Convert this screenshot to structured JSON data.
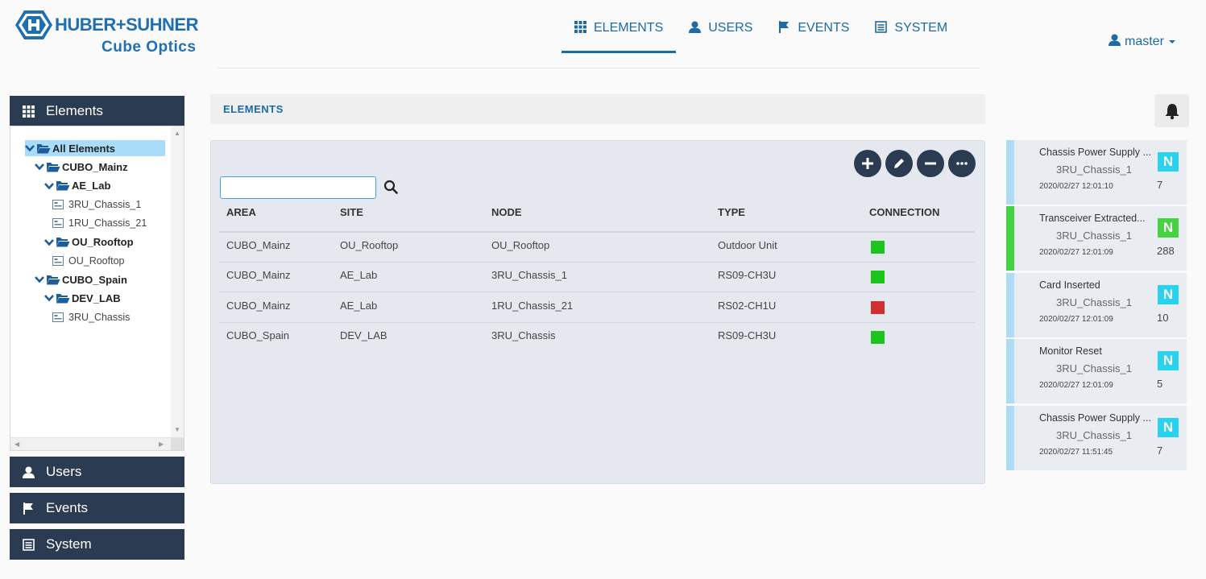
{
  "brand": {
    "name": "HUBER+SUHNER",
    "product": "Cube Optics"
  },
  "topnav": [
    {
      "label": "ELEMENTS",
      "icon": "grid-icon",
      "active": true
    },
    {
      "label": "USERS",
      "icon": "user-icon",
      "active": false
    },
    {
      "label": "EVENTS",
      "icon": "flag-icon",
      "active": false
    },
    {
      "label": "SYSTEM",
      "icon": "list-icon",
      "active": false
    }
  ],
  "user": {
    "name": "master",
    "icon": "user-icon"
  },
  "sidebar": {
    "elements_label": "Elements",
    "users_label": "Users",
    "events_label": "Events",
    "system_label": "System",
    "tree": [
      {
        "label": "All Elements",
        "type": "folder",
        "level": 0,
        "selected": true
      },
      {
        "label": "CUBO_Mainz",
        "type": "folder",
        "level": 1
      },
      {
        "label": "AE_Lab",
        "type": "folder",
        "level": 2
      },
      {
        "label": "3RU_Chassis_1",
        "type": "leaf",
        "level": 3
      },
      {
        "label": "1RU_Chassis_21",
        "type": "leaf",
        "level": 3
      },
      {
        "label": "OU_Rooftop",
        "type": "folder",
        "level": 2
      },
      {
        "label": "OU_Rooftop",
        "type": "leaf",
        "level": 3
      },
      {
        "label": "CUBO_Spain",
        "type": "folder",
        "level": 1
      },
      {
        "label": "DEV_LAB",
        "type": "folder",
        "level": 2
      },
      {
        "label": "3RU_Chassis",
        "type": "leaf",
        "level": 3
      }
    ]
  },
  "main": {
    "section_title": "ELEMENTS",
    "search": {
      "value": "",
      "placeholder": ""
    },
    "actions": [
      "add-icon",
      "edit-icon",
      "remove-icon",
      "more-icon"
    ],
    "columns": [
      "AREA",
      "SITE",
      "NODE",
      "TYPE",
      "CONNECTION"
    ],
    "rows": [
      {
        "area": "CUBO_Mainz",
        "site": "OU_Rooftop",
        "node": "OU_Rooftop",
        "type": "Outdoor Unit",
        "connection": "ok"
      },
      {
        "area": "CUBO_Mainz",
        "site": "AE_Lab",
        "node": "3RU_Chassis_1",
        "type": "RS09-CH3U",
        "connection": "ok"
      },
      {
        "area": "CUBO_Mainz",
        "site": "AE_Lab",
        "node": "1RU_Chassis_21",
        "type": "RS02-CH1U",
        "connection": "error"
      },
      {
        "area": "CUBO_Spain",
        "site": "DEV_LAB",
        "node": "3RU_Chassis",
        "type": "RS09-CH3U",
        "connection": "ok"
      }
    ]
  },
  "events": [
    {
      "title": "Chassis Power Supply ...",
      "node": "3RU_Chassis_1",
      "time": "2020/02/27 12:01:10",
      "badge": "N",
      "count": "7",
      "badge_color": "#29d3f0",
      "stripe_color": "#aedcf6"
    },
    {
      "title": "Transceiver Extracted...",
      "node": "3RU_Chassis_1",
      "time": "2020/02/27 12:01:09",
      "badge": "N",
      "count": "288",
      "badge_color": "#45d343",
      "stripe_color": "#45d343"
    },
    {
      "title": "Card Inserted",
      "node": "3RU_Chassis_1",
      "time": "2020/02/27 12:01:09",
      "badge": "N",
      "count": "10",
      "badge_color": "#29d3f0",
      "stripe_color": "#aedcf6"
    },
    {
      "title": "Monitor Reset",
      "node": "3RU_Chassis_1",
      "time": "2020/02/27 12:01:09",
      "badge": "N",
      "count": "5",
      "badge_color": "#29d3f0",
      "stripe_color": "#aedcf6"
    },
    {
      "title": "Chassis Power Supply ...",
      "node": "3RU_Chassis_1",
      "time": "2020/02/27 11:51:45",
      "badge": "N",
      "count": "7",
      "badge_color": "#29d3f0",
      "stripe_color": "#aedcf6"
    }
  ],
  "colors": {
    "brand_blue": "#1f6fb3",
    "nav_dark": "#2b3b51",
    "connection_ok": "#1ec41e",
    "connection_error": "#d03030"
  }
}
